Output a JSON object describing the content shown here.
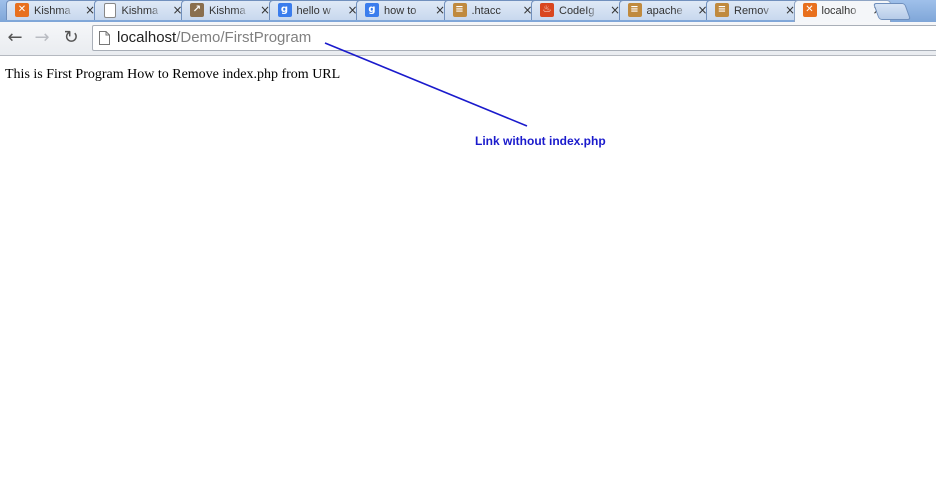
{
  "tabs": [
    {
      "label": "Kishma",
      "icon": "xampp-icon",
      "icon_color": "#e8701e",
      "icon_glyph": "✕",
      "active": false
    },
    {
      "label": "Kishma",
      "icon": "blank-page-icon",
      "icon_color": "#ffffff",
      "icon_glyph": "",
      "active": false
    },
    {
      "label": "Kishma",
      "icon": "site-favicon-icon",
      "icon_color": "#8a6f4e",
      "icon_glyph": "↗",
      "active": false
    },
    {
      "label": "hello w",
      "icon": "google-icon",
      "icon_color": "#3b7ded",
      "icon_glyph": "g",
      "active": false
    },
    {
      "label": "how to",
      "icon": "google-icon",
      "icon_color": "#3b7ded",
      "icon_glyph": "g",
      "active": false
    },
    {
      "label": ".htacc",
      "icon": "stackoverflow-icon",
      "icon_color": "#c08a3e",
      "icon_glyph": "≡",
      "active": false
    },
    {
      "label": "CodeIg",
      "icon": "codeigniter-icon",
      "icon_color": "#d9461f",
      "icon_glyph": "♨",
      "active": false
    },
    {
      "label": "apache",
      "icon": "stackoverflow-icon",
      "icon_color": "#c08a3e",
      "icon_glyph": "≡",
      "active": false
    },
    {
      "label": "Remov",
      "icon": "stackoverflow-icon",
      "icon_color": "#c08a3e",
      "icon_glyph": "≡",
      "active": false
    },
    {
      "label": "localho",
      "icon": "xampp-icon",
      "icon_color": "#e8701e",
      "icon_glyph": "✕",
      "active": true
    }
  ],
  "tab_close_glyph": "×",
  "toolbar": {
    "back_glyph": "←",
    "forward_glyph": "→",
    "reload_glyph": "↻"
  },
  "address": {
    "host": "localhost",
    "path": "/Demo/FirstProgram"
  },
  "page": {
    "text": "This is First Program How to Remove index.php from URL"
  },
  "annotation": {
    "text": "Link without index.php",
    "color": "#1a1acc"
  }
}
